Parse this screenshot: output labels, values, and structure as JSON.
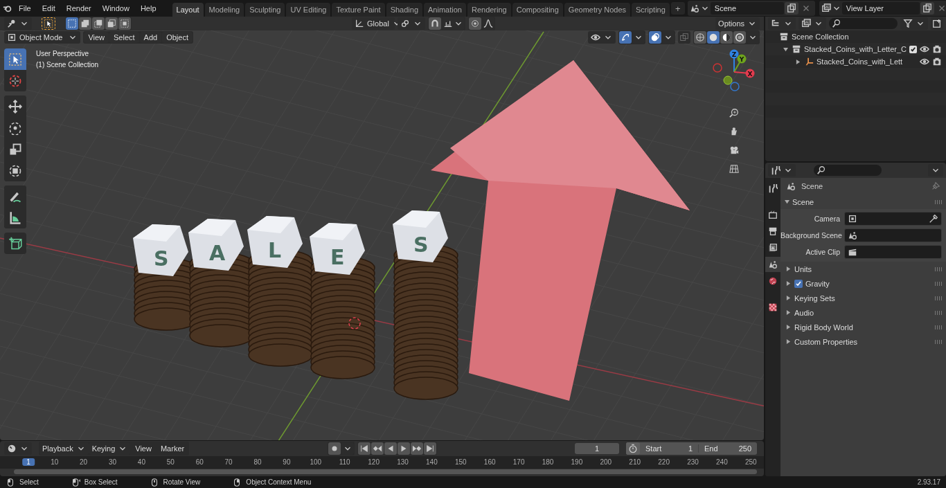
{
  "menu": [
    "File",
    "Edit",
    "Render",
    "Window",
    "Help"
  ],
  "workspaces": [
    {
      "label": "Layout",
      "selected": true
    },
    {
      "label": "Modeling",
      "selected": false
    },
    {
      "label": "Sculpting",
      "selected": false
    },
    {
      "label": "UV Editing",
      "selected": false
    },
    {
      "label": "Texture Paint",
      "selected": false
    },
    {
      "label": "Shading",
      "selected": false
    },
    {
      "label": "Animation",
      "selected": false
    },
    {
      "label": "Rendering",
      "selected": false
    },
    {
      "label": "Compositing",
      "selected": false
    },
    {
      "label": "Geometry Nodes",
      "selected": false
    },
    {
      "label": "Scripting",
      "selected": false
    }
  ],
  "add_workspace": "+",
  "scene_field": "Scene",
  "view_layer_field": "View Layer",
  "viewport": {
    "select_modes": [
      {
        "kind": "new",
        "selected": true
      },
      {
        "kind": "extend",
        "selected": false
      },
      {
        "kind": "subtract",
        "selected": false
      },
      {
        "kind": "invert",
        "selected": false
      },
      {
        "kind": "intersect",
        "selected": false
      }
    ],
    "orientation": "Global",
    "options": "Options",
    "mode": "Object Mode",
    "menus": [
      "View",
      "Select",
      "Add",
      "Object"
    ],
    "shading": [
      {
        "kind": "wireframe",
        "selected": false
      },
      {
        "kind": "solid",
        "selected": true
      },
      {
        "kind": "material",
        "selected": false
      },
      {
        "kind": "rendered",
        "selected": false
      }
    ],
    "overlay_lines": [
      "User Perspective",
      "(1) Scene Collection"
    ],
    "tools": [
      {
        "kind": "select",
        "selected": true
      },
      {
        "kind": "cursor",
        "selected": false
      },
      {
        "kind": "move",
        "selected": false
      },
      {
        "kind": "rotate",
        "selected": false
      },
      {
        "kind": "scale",
        "selected": false
      },
      {
        "kind": "transform",
        "selected": false
      },
      {
        "kind": "annotate",
        "selected": false
      },
      {
        "kind": "measure",
        "selected": false
      },
      {
        "kind": "add-cube",
        "selected": false
      }
    ],
    "gizmo_axes": [
      {
        "label": "Z",
        "color": "#2f83e3"
      },
      {
        "label": "Y",
        "color": "#6ea31c"
      },
      {
        "label": "X",
        "color": "#e33b4e"
      }
    ],
    "letters": [
      "S",
      "A",
      "L",
      "E",
      "S"
    ]
  },
  "outliner": {
    "root": "Scene Collection",
    "items": [
      {
        "label": "Stacked_Coins_with_Letter_C",
        "kind": "collection",
        "expanded": true,
        "checked": true,
        "children": [
          {
            "label": "Stacked_Coins_with_Lett",
            "kind": "object",
            "expanded": false
          }
        ]
      }
    ]
  },
  "properties": {
    "tabs": [
      {
        "kind": "tool",
        "selected": false
      },
      {
        "kind": "render",
        "selected": false
      },
      {
        "kind": "output",
        "selected": false
      },
      {
        "kind": "view-layer",
        "selected": false
      },
      {
        "kind": "scene",
        "selected": true
      },
      {
        "kind": "world",
        "selected": false
      },
      {
        "kind": "texture",
        "selected": false
      }
    ],
    "context": "Scene",
    "panel": {
      "title": "Scene",
      "expanded": true,
      "fields": [
        {
          "label": "Camera",
          "kind": "camera"
        },
        {
          "label": "Background Scene",
          "kind": "scene"
        },
        {
          "label": "Active Clip",
          "kind": "clip"
        }
      ]
    },
    "subpanels": [
      {
        "label": "Units",
        "expanded": false,
        "kind": "plain"
      },
      {
        "label": "Gravity",
        "expanded": false,
        "kind": "checkbox",
        "checked": true
      },
      {
        "label": "Keying Sets",
        "expanded": false,
        "kind": "plain"
      },
      {
        "label": "Audio",
        "expanded": false,
        "kind": "plain"
      },
      {
        "label": "Rigid Body World",
        "expanded": false,
        "kind": "plain"
      },
      {
        "label": "Custom Properties",
        "expanded": false,
        "kind": "plain"
      }
    ]
  },
  "timeline": {
    "menus": [
      {
        "label": "Playback",
        "kind": "dropdown"
      },
      {
        "label": "Keying",
        "kind": "dropdown"
      },
      {
        "label": "View",
        "kind": "plain"
      },
      {
        "label": "Marker",
        "kind": "plain"
      }
    ],
    "current_frame": "1",
    "start_label": "Start",
    "start": "1",
    "end_label": "End",
    "end": "250",
    "ticks": [
      {
        "label": "1",
        "selected": true
      },
      {
        "label": "10",
        "selected": false
      },
      {
        "label": "20",
        "selected": false
      },
      {
        "label": "30",
        "selected": false
      },
      {
        "label": "40",
        "selected": false
      },
      {
        "label": "50",
        "selected": false
      },
      {
        "label": "60",
        "selected": false
      },
      {
        "label": "70",
        "selected": false
      },
      {
        "label": "80",
        "selected": false
      },
      {
        "label": "90",
        "selected": false
      },
      {
        "label": "100",
        "selected": false
      },
      {
        "label": "110",
        "selected": false
      },
      {
        "label": "120",
        "selected": false
      },
      {
        "label": "130",
        "selected": false
      },
      {
        "label": "140",
        "selected": false
      },
      {
        "label": "150",
        "selected": false
      },
      {
        "label": "160",
        "selected": false
      },
      {
        "label": "170",
        "selected": false
      },
      {
        "label": "180",
        "selected": false
      },
      {
        "label": "190",
        "selected": false
      },
      {
        "label": "200",
        "selected": false
      },
      {
        "label": "210",
        "selected": false
      },
      {
        "label": "220",
        "selected": false
      },
      {
        "label": "230",
        "selected": false
      },
      {
        "label": "240",
        "selected": false
      },
      {
        "label": "250",
        "selected": false
      }
    ]
  },
  "status_bar": {
    "hints": [
      {
        "label": "Select",
        "kind": "left"
      },
      {
        "label": "Box Select",
        "kind": "drag"
      },
      {
        "label": "Rotate View",
        "kind": "middle"
      },
      {
        "label": "Object Context Menu",
        "kind": "right"
      }
    ],
    "version": "2.93.17"
  }
}
